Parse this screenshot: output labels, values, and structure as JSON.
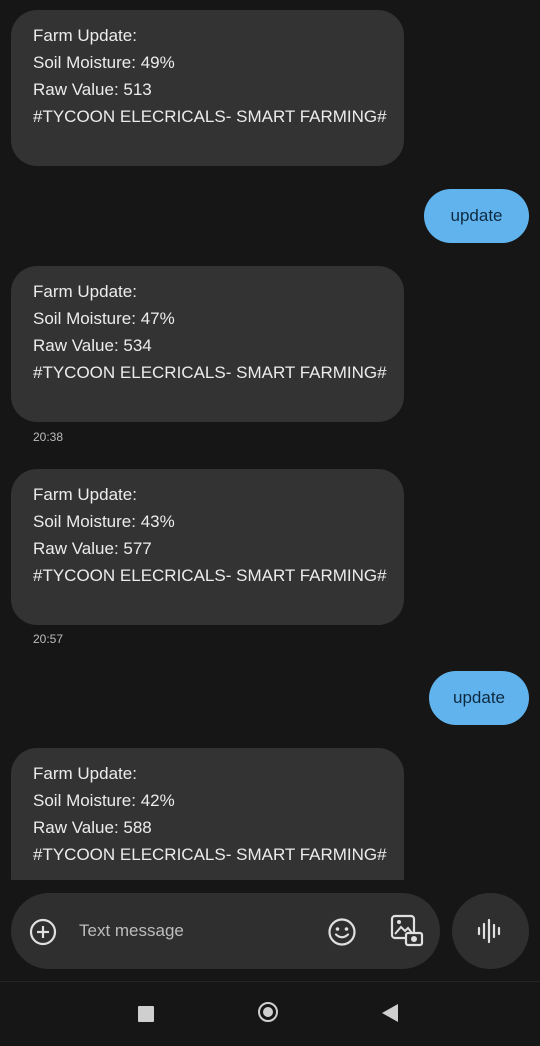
{
  "messages": [
    {
      "direction": "in",
      "lines": [
        "Farm Update:",
        "Soil Moisture: 49%",
        "Raw Value: 513",
        "#TYCOON ELECRICALS- SMART FARMING#"
      ]
    },
    {
      "direction": "out",
      "text": "update"
    },
    {
      "direction": "in",
      "lines": [
        "Farm Update:",
        "Soil Moisture: 47%",
        "Raw Value: 534",
        "#TYCOON ELECRICALS- SMART FARMING#"
      ],
      "timestamp": "20:38"
    },
    {
      "direction": "in",
      "lines": [
        "Farm Update:",
        "Soil Moisture: 43%",
        "Raw Value: 577",
        "#TYCOON ELECRICALS- SMART FARMING#"
      ],
      "timestamp": "20:57"
    },
    {
      "direction": "out",
      "text": "update"
    },
    {
      "direction": "in",
      "lines": [
        "Farm Update:",
        "Soil Moisture: 42%",
        "Raw Value: 588",
        "#TYCOON ELECRICALS- SMART FARMING#"
      ]
    }
  ],
  "composer": {
    "placeholder": "Text message",
    "icons": {
      "attach": "plus-circle-icon",
      "emoji": "emoji-icon",
      "gallery": "gallery-icon",
      "voice": "voice-waveform-icon"
    }
  },
  "navbar": {
    "icons": [
      "recents-square-icon",
      "home-circle-icon",
      "back-triangle-icon"
    ]
  },
  "colors": {
    "background": "#161616",
    "incoming_bubble": "#333333",
    "outgoing_bubble": "#61b3ee"
  }
}
